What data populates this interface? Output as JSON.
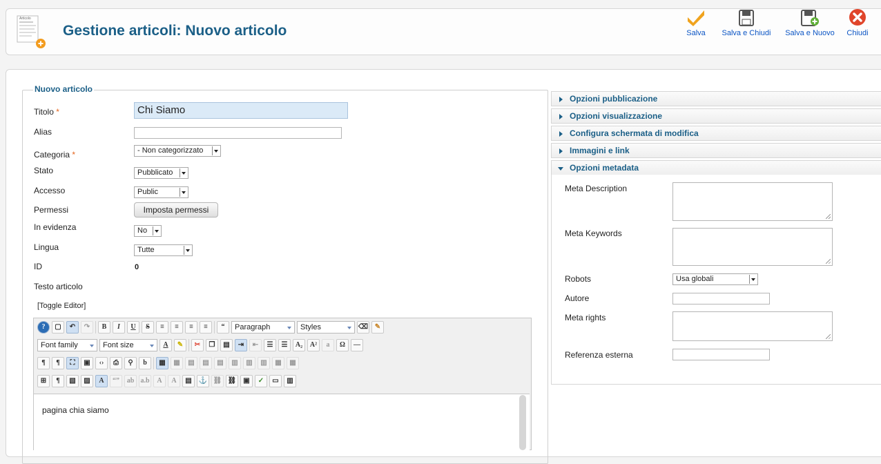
{
  "header": {
    "title": "Gestione articoli: Nuovo articolo",
    "icon_caption": "Articolo",
    "toolbar": {
      "save": "Salva",
      "save_close": "Salva e Chiudi",
      "save_new": "Salva e Nuovo",
      "close": "Chiudi"
    }
  },
  "form": {
    "legend": "Nuovo articolo",
    "required_mark": "*",
    "labels": {
      "title": "Titolo",
      "alias": "Alias",
      "category": "Categoria",
      "state": "Stato",
      "access": "Accesso",
      "permissions": "Permessi",
      "featured": "In evidenza",
      "language": "Lingua",
      "id": "ID",
      "article_text": "Testo articolo"
    },
    "values": {
      "title": "Chi Siamo",
      "alias": "",
      "category": "- Non categorizzato",
      "state": "Pubblicato",
      "access": "Public",
      "featured": "No",
      "language": "Tutte",
      "id": "0"
    },
    "permissions_button": "Imposta permessi",
    "toggle_editor": "[Toggle Editor]"
  },
  "editor": {
    "paragraph_select": "Paragraph",
    "styles_select": "Styles",
    "font_family_select": "Font family",
    "font_size_select": "Font size",
    "content": "pagina chia siamo"
  },
  "sidebar": {
    "panels": [
      {
        "label": "Opzioni pubblicazione",
        "expanded": false
      },
      {
        "label": "Opzioni visualizzazione",
        "expanded": false
      },
      {
        "label": "Configura schermata di modifica",
        "expanded": false
      },
      {
        "label": "Immagini e link",
        "expanded": false
      },
      {
        "label": "Opzioni metadata",
        "expanded": true
      }
    ],
    "metadata": {
      "meta_description": "Meta Description",
      "meta_keywords": "Meta Keywords",
      "robots": "Robots",
      "robots_value": "Usa globali",
      "author": "Autore",
      "meta_rights": "Meta rights",
      "external_ref": "Referenza esterna"
    }
  },
  "colors": {
    "title_blue": "#1b5f87",
    "link_blue": "#0b55c4",
    "save_orange": "#f0a31e",
    "close_red": "#e0452b",
    "required_orange": "#e5651d"
  },
  "icons": {
    "page": "article-add-icon",
    "save": "checkmark-icon",
    "save_close": "floppy-icon",
    "save_new": "floppy-plus-icon",
    "close": "close-circle-icon"
  }
}
